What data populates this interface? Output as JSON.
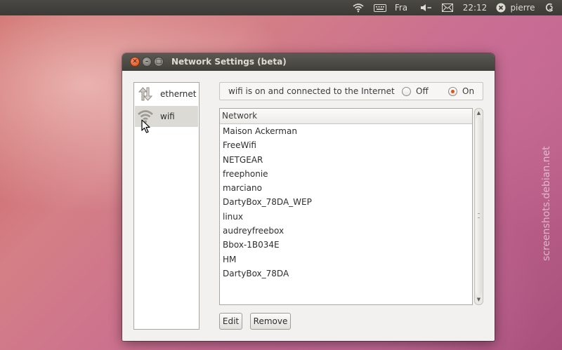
{
  "panel": {
    "keyboard_layout": "Fra",
    "clock": "22:12",
    "user": "pierre",
    "icons": [
      "wifi-icon",
      "keyboard-icon",
      "volume-icon",
      "mail-icon",
      "session-icon"
    ]
  },
  "window": {
    "title": "Network Settings (beta)",
    "buttons": [
      "close-icon",
      "minimize-icon",
      "maximize-icon"
    ]
  },
  "devices": [
    {
      "label": "ethernet",
      "icon": "ethernet-icon",
      "selected": false
    },
    {
      "label": "wifi",
      "icon": "wifi-icon",
      "selected": true
    }
  ],
  "status": {
    "text": "wifi is on and connected to the Internet",
    "off_label": "Off",
    "on_label": "On",
    "selected": "On"
  },
  "networks": {
    "header": "Network",
    "rows": [
      "Maison Ackerman",
      "FreeWifi",
      "NETGEAR",
      "freephonie",
      "marciano",
      "DartyBox_78DA_WEP",
      "linux",
      "audreyfreebox",
      "Bbox-1B034E",
      "HM",
      "DartyBox_78DA"
    ]
  },
  "actions": {
    "edit_label": "Edit",
    "remove_label": "Remove"
  },
  "watermark": "screenshots.debian.net",
  "colors": {
    "accent": "#e1521b",
    "panel": "#3b3a36",
    "selection": "#dcdad5"
  }
}
